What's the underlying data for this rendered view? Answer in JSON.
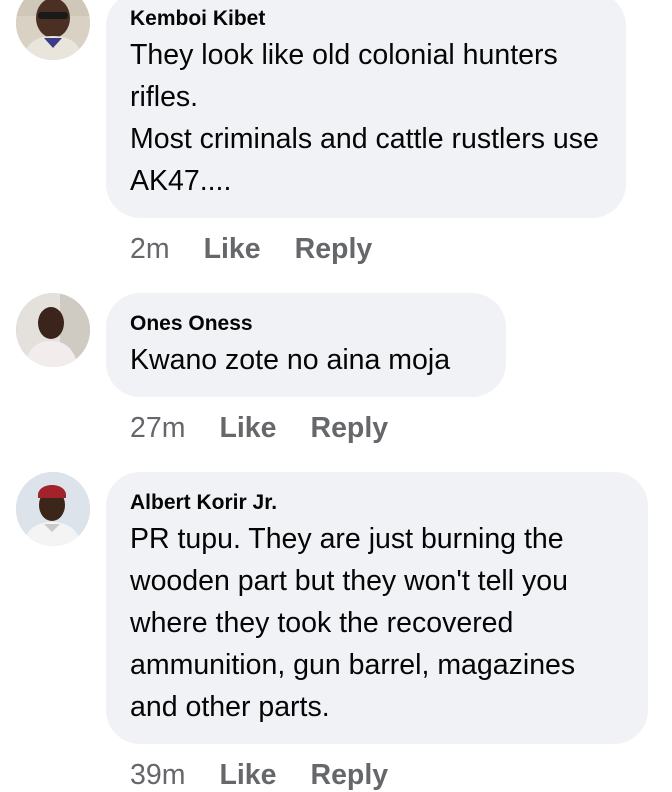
{
  "comments": [
    {
      "author": "Kemboi Kibet",
      "text": "They look like old colonial hunters rifles.\nMost criminals and cattle rustlers use AK47....",
      "time": "2m",
      "like_label": "Like",
      "reply_label": "Reply",
      "avatar_icon": "profile-photo-icon"
    },
    {
      "author": "Ones Oness",
      "text": "Kwano zote no aina moja",
      "time": "27m",
      "like_label": "Like",
      "reply_label": "Reply",
      "avatar_icon": "profile-photo-icon"
    },
    {
      "author": "Albert Korir Jr.",
      "text": "PR tupu. They are just burning the wooden part but they won't tell you where they took the recovered ammunition, gun barrel, magazines and other parts.",
      "time": "39m",
      "like_label": "Like",
      "reply_label": "Reply",
      "avatar_icon": "profile-photo-icon"
    }
  ],
  "colors": {
    "bubble_bg": "#f0f2f5",
    "meta_text": "#65676b",
    "body_text": "#050505"
  }
}
